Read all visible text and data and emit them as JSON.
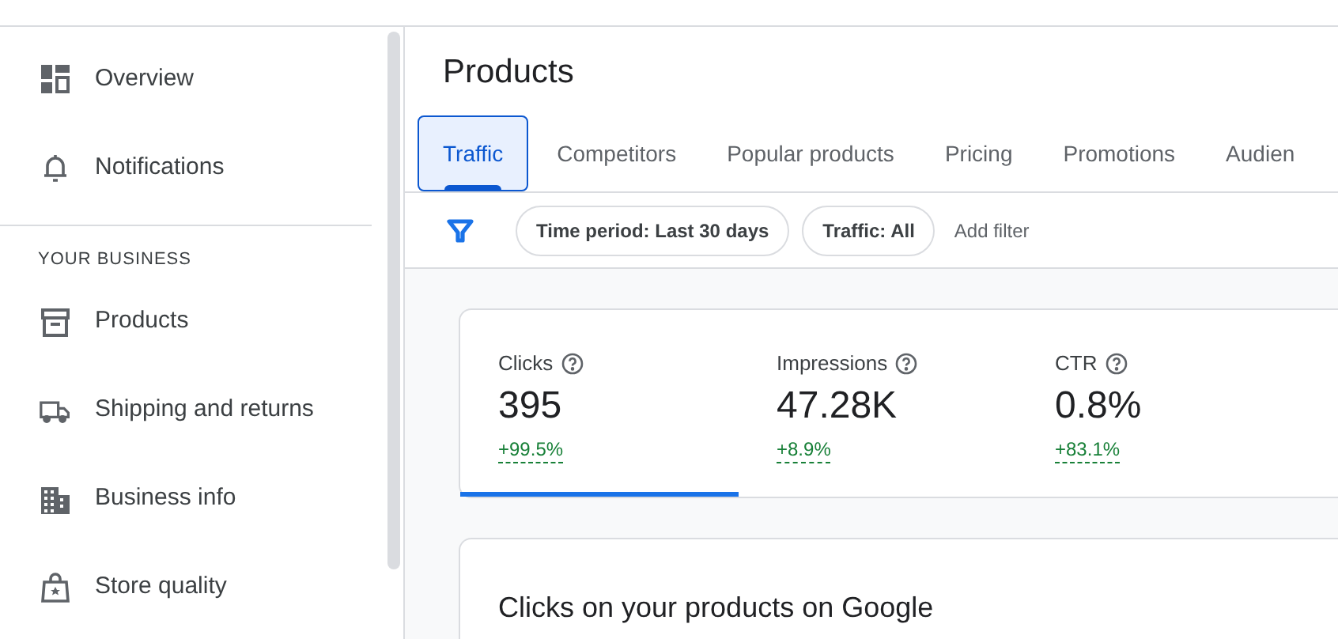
{
  "sidebar": {
    "items": [
      {
        "kind": "overview",
        "label": "Overview"
      },
      {
        "kind": "bell",
        "label": "Notifications"
      }
    ],
    "section_heading": "YOUR BUSINESS",
    "section_items": [
      {
        "kind": "box",
        "label": "Products"
      },
      {
        "kind": "truck",
        "label": "Shipping and returns"
      },
      {
        "kind": "building",
        "label": "Business info"
      },
      {
        "kind": "bag",
        "label": "Store quality"
      }
    ]
  },
  "page": {
    "title": "Products",
    "tabs": [
      {
        "label": "Traffic",
        "selected": true
      },
      {
        "label": "Competitors",
        "selected": false
      },
      {
        "label": "Popular products",
        "selected": false
      },
      {
        "label": "Pricing",
        "selected": false
      },
      {
        "label": "Promotions",
        "selected": false
      },
      {
        "label": "Audien",
        "selected": false
      }
    ],
    "filters": [
      {
        "label": "Time period: Last 30 days"
      },
      {
        "label": "Traffic: All"
      }
    ],
    "add_filter": "Add filter",
    "metrics": [
      {
        "label": "Clicks",
        "value": "395",
        "change": "+99.5%",
        "selected": true
      },
      {
        "label": "Impressions",
        "value": "47.28K",
        "change": "+8.9%",
        "selected": false
      },
      {
        "label": "CTR",
        "value": "0.8%",
        "change": "+83.1%",
        "selected": false
      }
    ],
    "chart_card": {
      "title": "Clicks on your products on Google"
    }
  }
}
